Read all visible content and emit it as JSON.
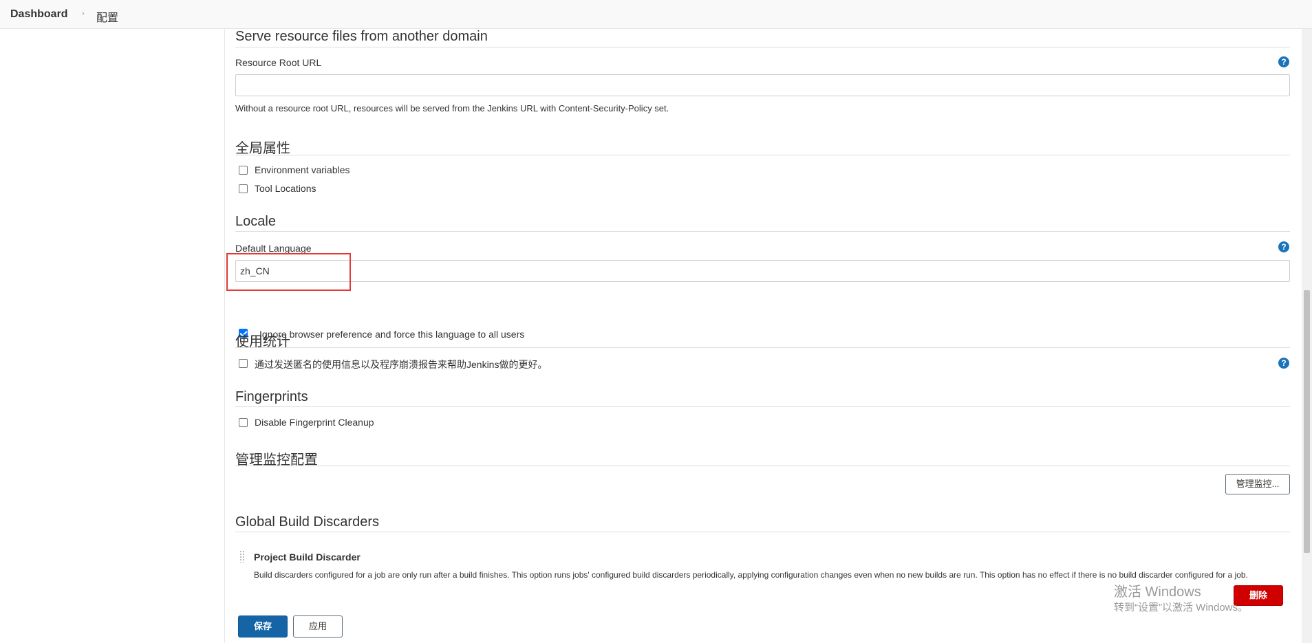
{
  "breadcrumb": {
    "home": "Dashboard",
    "separator": "›",
    "current": "配置"
  },
  "resource_root": {
    "section_title": "Serve resource files from another domain",
    "label": "Resource Root URL",
    "value": "",
    "description": "Without a resource root URL, resources will be served from the Jenkins URL with Content-Security-Policy set."
  },
  "global_properties": {
    "section_title": "全局属性",
    "options": [
      {
        "label": "Environment variables",
        "checked": false
      },
      {
        "label": "Tool Locations",
        "checked": false
      }
    ]
  },
  "locale": {
    "section_title": "Locale",
    "label": "Default Language",
    "value": "zh_CN",
    "ignore_browser_label": "Ignore browser preference and force this language to all users",
    "ignore_browser_checked": true
  },
  "usage_stats": {
    "section_title": "使用统计",
    "option_label": "通过发送匿名的使用信息以及程序崩溃报告来帮助Jenkins做的更好。",
    "checked": false
  },
  "fingerprints": {
    "section_title": "Fingerprints",
    "option_label": "Disable Fingerprint Cleanup",
    "checked": false
  },
  "monitors": {
    "section_title": "管理监控配置",
    "button_label": "管理监控..."
  },
  "build_discarders": {
    "section_title": "Global Build Discarders",
    "item_title": "Project Build Discarder",
    "item_description": "Build discarders configured for a job are only run after a build finishes. This option runs jobs' configured build discarders periodically, applying configuration changes even when no new builds are run. This option has no effect if there is no build discarder configured for a job.",
    "delete_label": "删除"
  },
  "actions": {
    "save_label": "保存",
    "apply_label": "应用"
  },
  "help_icon_glyph": "?",
  "watermark": {
    "line1": "激活 Windows",
    "line2": "转到“设置”以激活 Windows。"
  },
  "colors": {
    "primary": "#1565a6",
    "danger": "#d00000",
    "highlight": "#e53935",
    "help": "#1b74b8"
  }
}
